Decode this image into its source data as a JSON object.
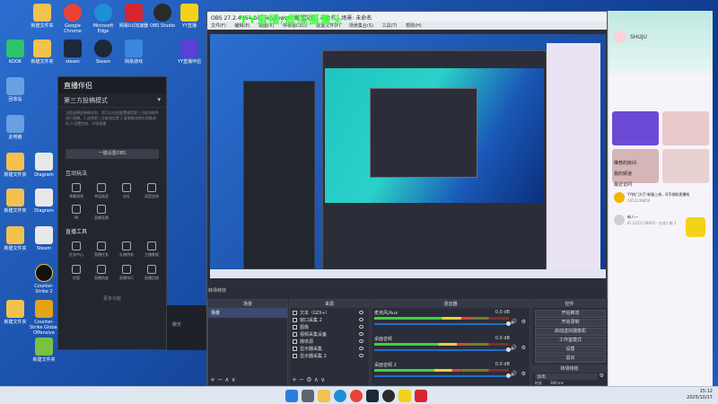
{
  "desktop": {
    "icons": [
      {
        "label": "新建文件夹",
        "color": "#f2c14e"
      },
      {
        "label": "Google Chrome",
        "color": "#e94335"
      },
      {
        "label": "Microsoft Edge",
        "color": "#1f8fd8"
      },
      {
        "label": "网易UU加速器",
        "color": "#d8242d"
      },
      {
        "label": "OBS Studio",
        "color": "#2a2a2a"
      },
      {
        "label": "YY直播",
        "color": "#f3d21a"
      },
      {
        "label": "KOOK",
        "color": "#2ec26a"
      },
      {
        "label": "新建文件夹",
        "color": "#f2c14e"
      },
      {
        "label": "steam",
        "color": "#1b2838"
      },
      {
        "label": "Steam",
        "color": "#1b2838"
      },
      {
        "label": "网易游戏",
        "color": "#3a87e0"
      },
      {
        "label": "YY直播伴侣",
        "color": "#5b3fd6"
      },
      {
        "label": "回收站",
        "color": "#6a9fe0"
      },
      {
        "label": "此电脑",
        "color": "#6a9fe0"
      },
      {
        "label": "新建文件夹",
        "color": "#f2c14e"
      },
      {
        "label": "Diagram",
        "color": "#e8e8e8"
      },
      {
        "label": "新建文件夹",
        "color": "#f2c14e"
      },
      {
        "label": "Diagram",
        "color": "#e8e8e8"
      },
      {
        "label": "新建文件夹",
        "color": "#f2c14e"
      },
      {
        "label": "Steam",
        "color": "#e8e8e8"
      },
      {
        "label": "Counter-Strike 2",
        "color": "#111111"
      },
      {
        "label": "Counter-Strike Global Offensive",
        "color": "#e3a21a"
      },
      {
        "label": "新建文件夹",
        "color": "#f2c14e"
      },
      {
        "label": "新建文件夹",
        "color": "#7ac143"
      }
    ]
  },
  "helper": {
    "title": "直播伴侣",
    "menu_label": "第三方投稿模式",
    "notice": "当您选择这种模式时，您可以在此配置使用第三方推流软件进行直播。1.选择第三方推流设置 2.复制推流地址和推流码 3.设置完成，开始直播",
    "button": "一键设置OBS",
    "section_interact": "互动玩法",
    "interact_items": [
      "弹幕游戏",
      "幸运抽奖",
      "送礼",
      "语音连线",
      "PK",
      "直播竞猜"
    ],
    "section_tools": "直播工具",
    "tool_items": [
      "任务中心",
      "直播任务",
      "礼物特效",
      "主播数据",
      "房管",
      "直播热度",
      "直播排行",
      "直播回放"
    ],
    "more_label": "更多功能",
    "chat_label": "聊天"
  },
  "obs": {
    "window_title": "OBS 27.2.4 (64-bit, windows) - 配置文件: 未命名 - 场景: 未命名",
    "overlay_text": "YY直播/虚拟摄像头",
    "menus": [
      "文件(F)",
      "编辑(E)",
      "视图(V)",
      "停靠窗口(D)",
      "配置文件(P)",
      "场景集合(S)",
      "工具(T)",
      "帮助(H)"
    ],
    "scenes": {
      "title": "场景",
      "items": [
        "场景"
      ]
    },
    "sources": {
      "title": "来源",
      "items": [
        "文本（GDI+）",
        "窗口采集 2",
        "图像",
        "视频采集设备",
        "媒体源",
        "显示器采集",
        "显示器采集 2"
      ]
    },
    "transition_label": "转场特效",
    "mixer": {
      "title": "混音器",
      "tracks": [
        {
          "name": "麦克风/Aux",
          "db": "0.0 dB",
          "level": 0.72
        },
        {
          "name": "桌面音频",
          "db": "0.0 dB",
          "level": 0.68
        },
        {
          "name": "桌面音频 2",
          "db": "0.0 dB",
          "level": 0.64
        }
      ]
    },
    "controls": {
      "title": "控件",
      "buttons": [
        "开始推流",
        "开始录制",
        "启动虚拟摄像机",
        "工作室模式",
        "设置",
        "退出"
      ]
    },
    "transitions": {
      "title": "转场特效",
      "type": "淡出",
      "duration_label": "时长",
      "duration": "300 ms"
    }
  },
  "yy_app": {
    "username": "SHUJU",
    "section1": "推荐的房间",
    "section2": "我的频道",
    "section3": "最近访问",
    "recent_items": [
      {
        "title": "YY热门大厅·新服上线，Q币领取直播啦",
        "sub": "1452139854"
      },
      {
        "title": "新人一",
        "sub": "ID 1452139854 · 在线人数 1"
      }
    ]
  },
  "taskbar": {
    "time": "15:12",
    "date": "2025/10/17"
  }
}
